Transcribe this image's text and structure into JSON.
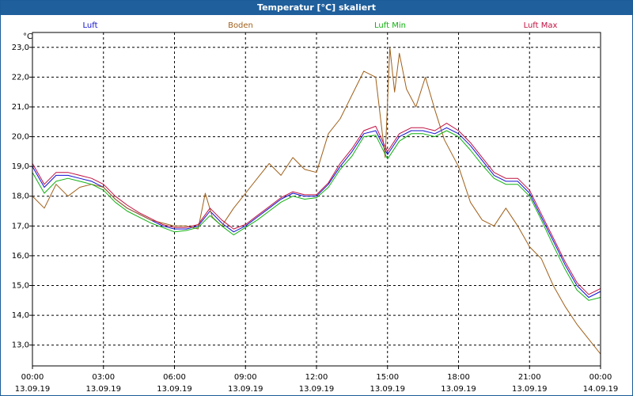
{
  "window": {
    "title": "Temperatur [°C] skaliert"
  },
  "legend": [
    {
      "name": "Luft",
      "color": "#1010d0"
    },
    {
      "name": "Boden",
      "color": "#a0601a"
    },
    {
      "name": "Luft Min",
      "color": "#10b010"
    },
    {
      "name": "Luft Max",
      "color": "#c01040"
    }
  ],
  "chart_data": {
    "type": "line",
    "title": "Temperatur [°C] skaliert",
    "ylabel": "°C",
    "xlabel": "",
    "ylim": [
      12.3,
      23.5
    ],
    "xlim_hours": [
      0,
      24
    ],
    "grid": true,
    "legend_position": "top",
    "y_ticks": [
      "13,0",
      "14,0",
      "15,0",
      "16,0",
      "17,0",
      "18,0",
      "19,0",
      "20,0",
      "21,0",
      "22,0",
      "23,0"
    ],
    "x_ticks": [
      {
        "time": "00:00",
        "date": "13.09.19"
      },
      {
        "time": "03:00",
        "date": "13.09.19"
      },
      {
        "time": "06:00",
        "date": "13.09.19"
      },
      {
        "time": "09:00",
        "date": "13.09.19"
      },
      {
        "time": "12:00",
        "date": "13.09.19"
      },
      {
        "time": "15:00",
        "date": "13.09.19"
      },
      {
        "time": "18:00",
        "date": "13.09.19"
      },
      {
        "time": "21:00",
        "date": "13.09.19"
      },
      {
        "time": "00:00",
        "date": "14.09.19"
      }
    ],
    "series": [
      {
        "name": "Luft",
        "color": "#1010d0",
        "x": [
          0,
          0.5,
          1,
          1.5,
          2,
          2.5,
          3,
          3.5,
          4,
          4.5,
          5,
          5.5,
          6,
          6.5,
          7,
          7.5,
          8,
          8.5,
          9,
          9.5,
          10,
          10.5,
          11,
          11.5,
          12,
          12.5,
          13,
          13.5,
          14,
          14.5,
          15,
          15.5,
          16,
          16.5,
          17,
          17.5,
          18,
          18.5,
          19,
          19.5,
          20,
          20.5,
          21,
          21.5,
          22,
          22.5,
          23,
          23.5,
          24
        ],
        "y": [
          19.0,
          18.3,
          18.7,
          18.7,
          18.6,
          18.5,
          18.3,
          17.9,
          17.6,
          17.4,
          17.2,
          17.0,
          16.9,
          16.9,
          17.0,
          17.5,
          17.1,
          16.8,
          17.0,
          17.3,
          17.6,
          17.9,
          18.1,
          18.0,
          18.0,
          18.4,
          19.0,
          19.5,
          20.1,
          20.2,
          19.4,
          20.0,
          20.2,
          20.2,
          20.1,
          20.3,
          20.1,
          19.7,
          19.2,
          18.7,
          18.5,
          18.5,
          18.1,
          17.3,
          16.5,
          15.7,
          15.0,
          14.6,
          14.8
        ]
      },
      {
        "name": "Boden",
        "color": "#a0601a",
        "x": [
          0,
          0.5,
          1,
          1.5,
          2,
          2.5,
          3,
          3.5,
          4,
          4.5,
          5,
          5.5,
          6,
          6.5,
          7,
          7.3,
          7.6,
          8,
          8.5,
          9,
          9.5,
          10,
          10.5,
          11,
          11.5,
          12,
          12.5,
          13,
          13.5,
          14,
          14.5,
          14.9,
          15.1,
          15.3,
          15.5,
          15.8,
          16.2,
          16.6,
          17,
          17.4,
          18,
          18.5,
          19,
          19.5,
          20,
          20.5,
          21,
          21.5,
          22,
          22.5,
          23,
          23.5,
          24
        ],
        "y": [
          18.0,
          17.6,
          18.4,
          18.0,
          18.3,
          18.4,
          18.3,
          17.9,
          17.6,
          17.4,
          17.2,
          17.1,
          17.0,
          17.0,
          16.9,
          18.1,
          17.3,
          17.0,
          17.6,
          18.1,
          18.6,
          19.1,
          18.7,
          19.3,
          18.9,
          18.8,
          20.1,
          20.6,
          21.4,
          22.2,
          22.0,
          19.3,
          23.0,
          21.5,
          22.8,
          21.6,
          21.0,
          22.0,
          20.9,
          19.9,
          19.0,
          17.8,
          17.2,
          17.0,
          17.6,
          17.0,
          16.3,
          15.9,
          15.0,
          14.3,
          13.7,
          13.2,
          12.7
        ]
      },
      {
        "name": "Luft Min",
        "color": "#10b010",
        "x": [
          0,
          0.5,
          1,
          1.5,
          2,
          2.5,
          3,
          3.5,
          4,
          4.5,
          5,
          5.5,
          6,
          6.5,
          7,
          7.5,
          8,
          8.5,
          9,
          9.5,
          10,
          10.5,
          11,
          11.5,
          12,
          12.5,
          13,
          13.5,
          14,
          14.5,
          15,
          15.5,
          16,
          16.5,
          17,
          17.5,
          18,
          18.5,
          19,
          19.5,
          20,
          20.5,
          21,
          21.5,
          22,
          22.5,
          23,
          23.5,
          24
        ],
        "y": [
          18.8,
          18.1,
          18.5,
          18.6,
          18.5,
          18.4,
          18.2,
          17.8,
          17.5,
          17.3,
          17.1,
          16.95,
          16.8,
          16.85,
          16.95,
          17.35,
          17.0,
          16.7,
          16.95,
          17.2,
          17.5,
          17.8,
          18.0,
          17.9,
          17.95,
          18.3,
          18.9,
          19.35,
          20.0,
          20.05,
          19.25,
          19.85,
          20.1,
          20.1,
          20.0,
          20.2,
          20.0,
          19.55,
          19.05,
          18.6,
          18.4,
          18.4,
          18.0,
          17.2,
          16.35,
          15.55,
          14.85,
          14.5,
          14.6
        ]
      },
      {
        "name": "Luft Max",
        "color": "#c01040",
        "x": [
          0,
          0.5,
          1,
          1.5,
          2,
          2.5,
          3,
          3.5,
          4,
          4.5,
          5,
          5.5,
          6,
          6.5,
          7,
          7.5,
          8,
          8.5,
          9,
          9.5,
          10,
          10.5,
          11,
          11.5,
          12,
          12.5,
          13,
          13.5,
          14,
          14.5,
          15,
          15.5,
          16,
          16.5,
          17,
          17.5,
          18,
          18.5,
          19,
          19.5,
          20,
          20.5,
          21,
          21.5,
          22,
          22.5,
          23,
          23.5,
          24
        ],
        "y": [
          19.1,
          18.4,
          18.8,
          18.8,
          18.7,
          18.6,
          18.4,
          18.0,
          17.7,
          17.45,
          17.25,
          17.05,
          16.95,
          16.95,
          17.05,
          17.6,
          17.2,
          16.9,
          17.05,
          17.35,
          17.65,
          17.95,
          18.15,
          18.05,
          18.05,
          18.45,
          19.1,
          19.6,
          20.2,
          20.35,
          19.5,
          20.1,
          20.3,
          20.3,
          20.2,
          20.45,
          20.2,
          19.8,
          19.3,
          18.8,
          18.6,
          18.6,
          18.2,
          17.4,
          16.6,
          15.8,
          15.1,
          14.7,
          14.9
        ]
      }
    ]
  }
}
